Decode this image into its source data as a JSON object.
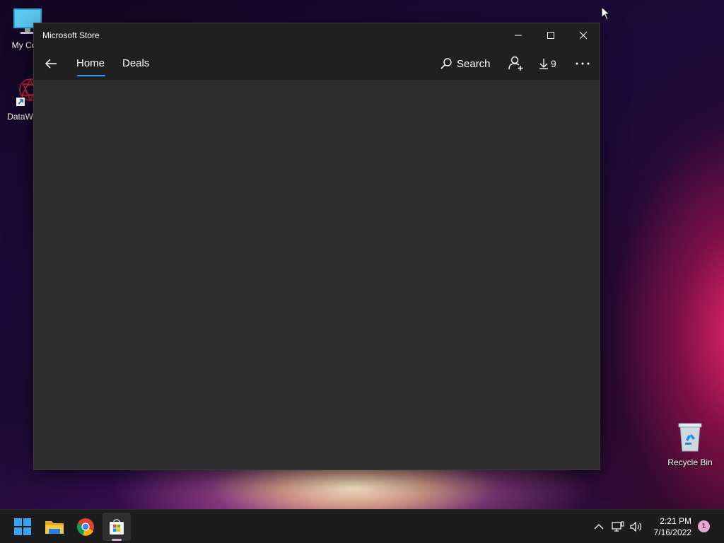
{
  "desktop": {
    "icons": [
      {
        "label": "My Com",
        "icon": "computer-icon"
      },
      {
        "label": "DataWag",
        "icon": "datawag-app-icon"
      },
      {
        "label": "Recycle Bin",
        "icon": "recycle-bin-icon"
      }
    ]
  },
  "window": {
    "title": "Microsoft Store",
    "caption_buttons": [
      "minimize",
      "maximize",
      "close"
    ],
    "nav": {
      "back_icon": "back-arrow-icon",
      "tabs": [
        {
          "label": "Home",
          "selected": true
        },
        {
          "label": "Deals",
          "selected": false
        }
      ],
      "search_label": "Search",
      "account_icon": "add-user-icon",
      "downloads_count": "9",
      "more_icon": "more-ellipsis-icon"
    }
  },
  "taskbar": {
    "apps": [
      {
        "name": "Start",
        "icon": "windows-start-icon"
      },
      {
        "name": "File Explorer",
        "icon": "folder-icon"
      },
      {
        "name": "Google Chrome",
        "icon": "chrome-icon"
      },
      {
        "name": "Microsoft Store",
        "icon": "store-icon",
        "active": true
      }
    ],
    "tray": {
      "time": "2:21 PM",
      "date": "7/16/2022",
      "notification_count": "1"
    }
  },
  "colors": {
    "accent": "#3b8ff0",
    "window_bg": "#2b2b2b",
    "titlebar_bg": "#202020",
    "taskbar_bg": "#1c1c1c",
    "badge": "#e9a3d6"
  }
}
